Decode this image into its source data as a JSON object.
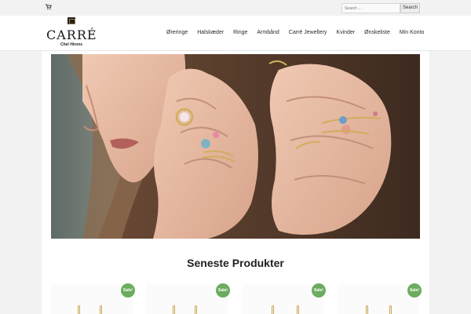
{
  "topbar": {
    "cart_icon": "shopping-cart-icon",
    "search": {
      "placeholder": "Search …",
      "button_label": "Search"
    }
  },
  "header": {
    "logo": {
      "title": "CARRÉ",
      "subtitle": "Chel Hirons"
    },
    "nav": [
      "Øreringe",
      "Halskæder",
      "Ringe",
      "Armbånd",
      "Carré Jewellery",
      "Kvinder",
      "Ønskeliste",
      "Min Konto"
    ]
  },
  "hero": {
    "image": "woman-wearing-gold-rings-with-colored-stones"
  },
  "section": {
    "title": "Seneste Produkter"
  },
  "products": [
    {
      "badge": "Sale!"
    },
    {
      "badge": "Sale!"
    },
    {
      "badge": "Sale!"
    },
    {
      "badge": "Sale!"
    }
  ],
  "colors": {
    "sale_badge": "#6bac5f",
    "gold": "#c9a44c",
    "page_background": "#f2f2f2"
  }
}
